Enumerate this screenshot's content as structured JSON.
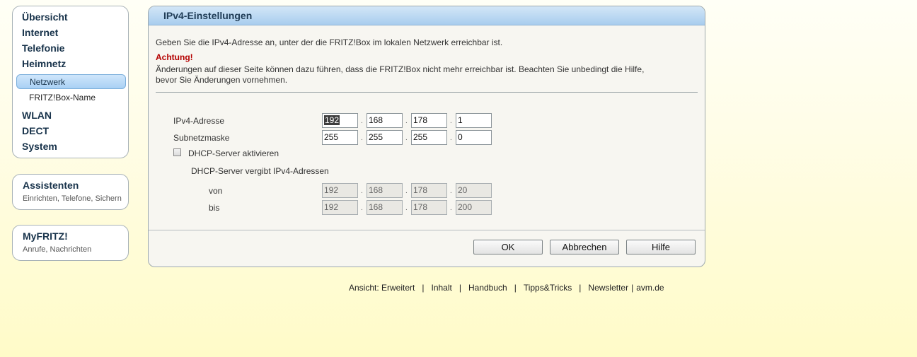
{
  "nav": {
    "items": [
      {
        "label": "Übersicht"
      },
      {
        "label": "Internet"
      },
      {
        "label": "Telefonie"
      },
      {
        "label": "Heimnetz"
      }
    ],
    "subitems": [
      {
        "label": "Netzwerk",
        "active": true
      },
      {
        "label": "FRITZ!Box-Name",
        "active": false
      }
    ],
    "items_after": [
      {
        "label": "WLAN"
      },
      {
        "label": "DECT"
      },
      {
        "label": "System"
      }
    ]
  },
  "assistenten": {
    "title": "Assistenten",
    "subtitle": "Einrichten, Telefone, Sichern"
  },
  "myfritz": {
    "title": "MyFRITZ!",
    "subtitle": "Anrufe, Nachrichten"
  },
  "panel": {
    "title": "IPv4-Einstellungen",
    "intro": "Geben Sie die IPv4-Adresse an, unter der die FRITZ!Box im lokalen Netzwerk erreichbar ist.",
    "warning_title": "Achtung!",
    "warning_line1": "Änderungen auf dieser Seite können dazu führen, dass die FRITZ!Box nicht mehr erreichbar ist. Beachten Sie unbedingt die Hilfe,",
    "warning_line2": "bevor Sie Änderungen vornehmen.",
    "ip_label": "IPv4-Adresse",
    "ip": [
      "192",
      "168",
      "178",
      "1"
    ],
    "mask_label": "Subnetzmaske",
    "mask": [
      "255",
      "255",
      "255",
      "0"
    ],
    "dhcp_checkbox_label": "DHCP-Server aktivieren",
    "dhcp_checked": false,
    "dhcp_range_label": "DHCP-Server vergibt IPv4-Adressen",
    "from_label": "von",
    "from": [
      "192",
      "168",
      "178",
      "20"
    ],
    "to_label": "bis",
    "to": [
      "192",
      "168",
      "178",
      "200"
    ],
    "separator": ".",
    "buttons": {
      "ok": "OK",
      "cancel": "Abbrechen",
      "help": "Hilfe"
    }
  },
  "footer": {
    "view": "Ansicht: Erweitert",
    "inhalt": "Inhalt",
    "handbuch": "Handbuch",
    "tipps": "Tipps&Tricks",
    "newsletter": "Newsletter",
    "avm": "avm.de",
    "sep": "|"
  }
}
